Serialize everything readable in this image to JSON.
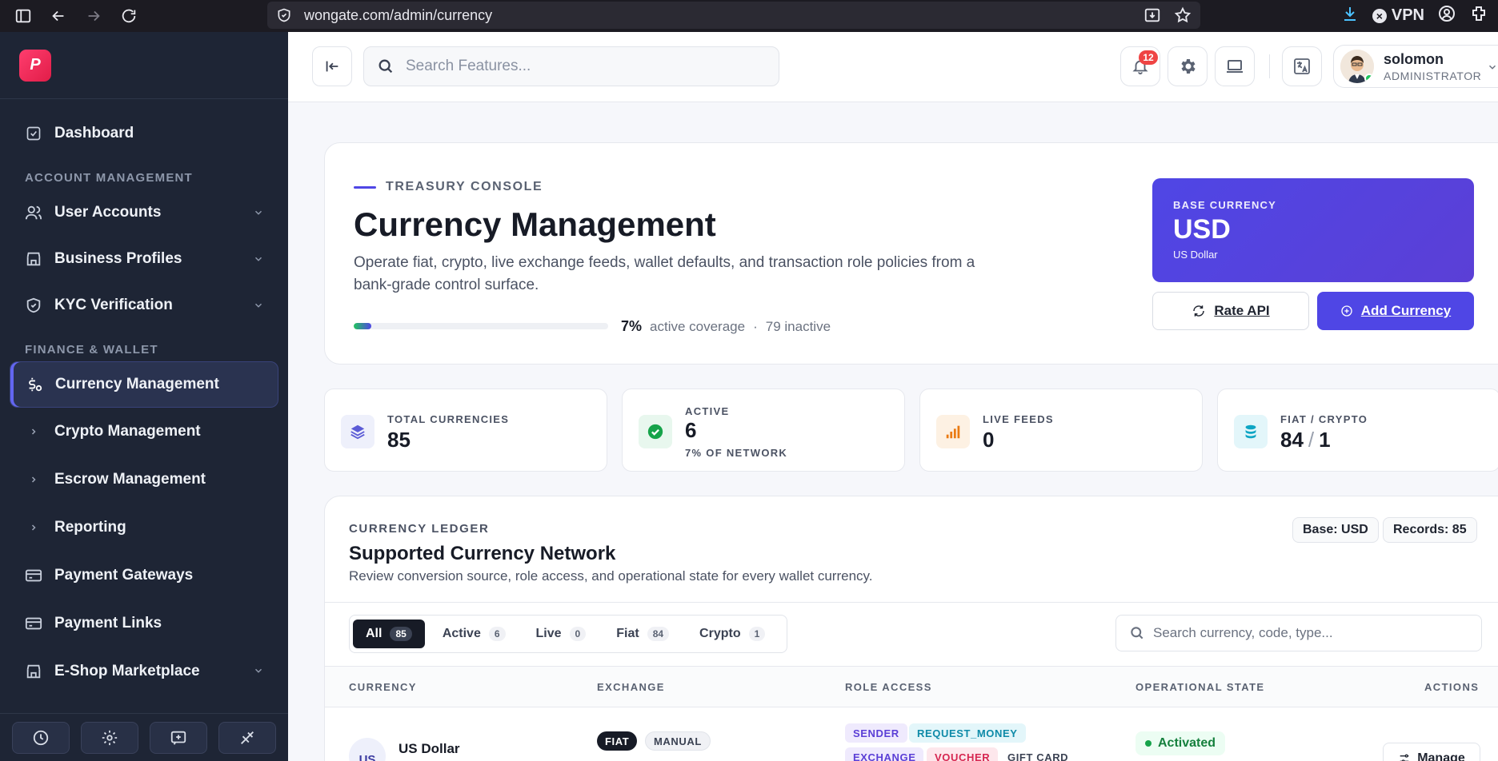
{
  "browser": {
    "url": "wongate.com/admin/currency",
    "vpn_label": "VPN"
  },
  "sidebar": {
    "logo_icon": "brand-logo",
    "items": [
      {
        "label": "Dashboard",
        "icon": "dashboard-icon"
      },
      {
        "section": "ACCOUNT MANAGEMENT"
      },
      {
        "label": "User Accounts",
        "icon": "users-icon",
        "expandable": true
      },
      {
        "label": "Business Profiles",
        "icon": "store-icon",
        "expandable": true
      },
      {
        "label": "KYC Verification",
        "icon": "shield-check-icon",
        "expandable": true
      },
      {
        "section": "FINANCE & WALLET"
      },
      {
        "label": "Currency Management",
        "icon": "currency-icon",
        "active": true
      },
      {
        "label": "Crypto Management",
        "icon": "chevron-right-icon"
      },
      {
        "label": "Escrow Management",
        "icon": "chevron-right-icon"
      },
      {
        "label": "Reporting",
        "icon": "chevron-right-icon"
      },
      {
        "label": "Payment Gateways",
        "icon": "card-icon"
      },
      {
        "label": "Payment Links",
        "icon": "card-icon"
      },
      {
        "label": "E-Shop Marketplace",
        "icon": "shop-icon",
        "expandable": true
      }
    ],
    "footer_buttons": [
      "clock-icon",
      "gear-icon",
      "add-note-icon",
      "signal-icon"
    ]
  },
  "header": {
    "search_placeholder": "Search Features...",
    "notifications_count": "12",
    "user": {
      "name": "solomon",
      "role": "ADMINISTRATOR"
    }
  },
  "hero": {
    "kicker": "TREASURY CONSOLE",
    "title": "Currency Management",
    "description": "Operate fiat, crypto, live exchange feeds, wallet defaults, and transaction role policies from a bank-grade control surface.",
    "coverage_pct": "7%",
    "coverage_fraction": 0.07,
    "coverage_label": "active coverage",
    "separator": "·",
    "inactive_label": "79 inactive",
    "base_currency": {
      "label": "BASE CURRENCY",
      "code": "USD",
      "name": "US Dollar"
    },
    "rate_api_label": "Rate API",
    "add_currency_label": "Add Currency"
  },
  "stats": [
    {
      "label": "TOTAL CURRENCIES",
      "value": "85",
      "icon": "layers-icon",
      "color": "#5b5bd6",
      "bg": "#eef0fb"
    },
    {
      "label": "ACTIVE",
      "value": "6",
      "sub": "7% OF NETWORK",
      "icon": "check-circle-icon",
      "color": "#16a34a",
      "bg": "#e8f7ee"
    },
    {
      "label": "LIVE FEEDS",
      "value": "0",
      "icon": "signal-bars-icon",
      "color": "#ea7a12",
      "bg": "#fdf1e3"
    },
    {
      "label": "FIAT / CRYPTO",
      "value_fiat": "84",
      "slash": "/",
      "value_crypto": "1",
      "icon": "coins-icon",
      "color": "#0ea5c4",
      "bg": "#e3f6fa"
    }
  ],
  "ledger": {
    "kicker": "CURRENCY LEDGER",
    "title": "Supported Currency Network",
    "description": "Review conversion source, role access, and operational state for every wallet currency.",
    "base_pill": "Base: USD",
    "records_pill": "Records: 85",
    "tabs": [
      {
        "label": "All",
        "count": "85",
        "active": true
      },
      {
        "label": "Active",
        "count": "6"
      },
      {
        "label": "Live",
        "count": "0"
      },
      {
        "label": "Fiat",
        "count": "84"
      },
      {
        "label": "Crypto",
        "count": "1"
      }
    ],
    "search_placeholder": "Search currency, code, type...",
    "columns": [
      "CURRENCY",
      "EXCHANGE",
      "ROLE ACCESS",
      "OPERATIONAL STATE",
      "ACTIONS"
    ],
    "rows": [
      {
        "code": "US",
        "name": "US Dollar",
        "exchange_tags": [
          "FIAT",
          "MANUAL"
        ],
        "roles": [
          "SENDER",
          "REQUEST_MONEY",
          "EXCHANGE",
          "VOUCHER",
          "GIFT CARD"
        ],
        "state": "Activated",
        "action": "Manage"
      }
    ]
  }
}
